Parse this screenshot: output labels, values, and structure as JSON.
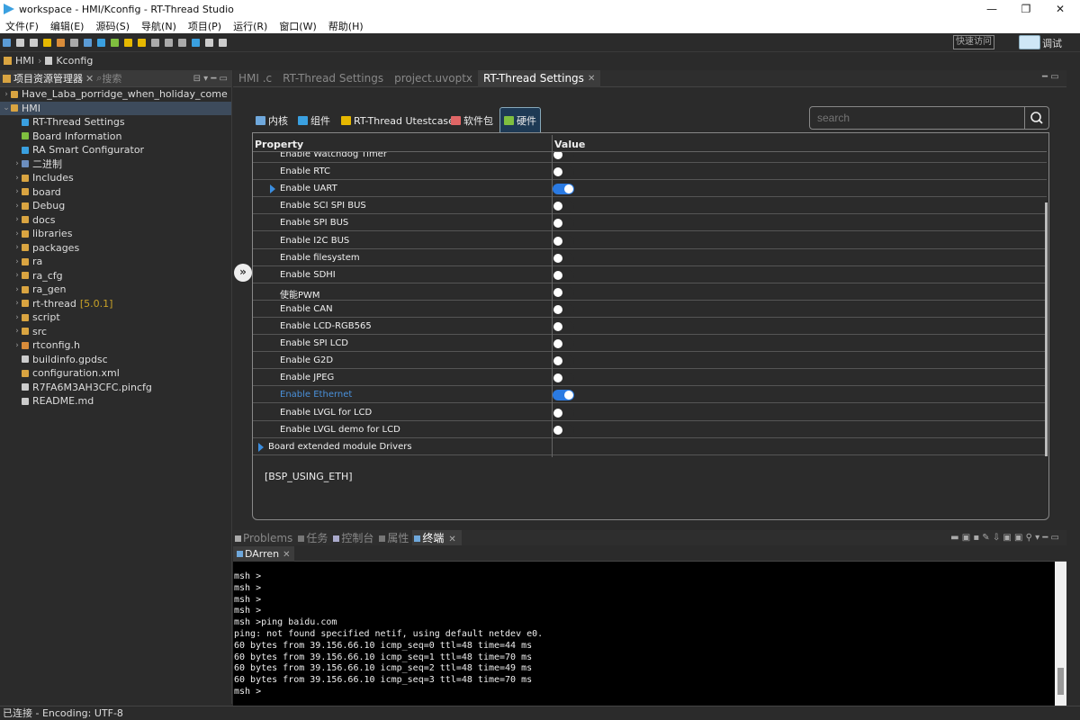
{
  "window": {
    "title": "workspace - HMI/Kconfig - RT-Thread Studio"
  },
  "menu": [
    "文件(F)",
    "编辑(E)",
    "源码(S)",
    "导航(N)",
    "项目(P)",
    "运行(R)",
    "窗口(W)",
    "帮助(H)"
  ],
  "toolbar": {
    "quick_access": "快速访问",
    "debug_label": "调试"
  },
  "breadcrumb": {
    "project": "HMI",
    "file": "Kconfig"
  },
  "explorer": {
    "tab_label": "项目资源管理器",
    "search_tab": "搜索",
    "items": [
      {
        "label": "Have_Laba_porridge_when_holiday_come",
        "level": 0,
        "twist": "›",
        "color": "#d9a441"
      },
      {
        "label": "HMI",
        "level": 0,
        "twist": "⌄",
        "color": "#d9a441",
        "selected": true
      },
      {
        "label": "RT-Thread Settings",
        "level": 1,
        "twist": "",
        "color": "#3aa0e0"
      },
      {
        "label": "Board Information",
        "level": 1,
        "twist": "",
        "color": "#7fbf3f"
      },
      {
        "label": "RA Smart Configurator",
        "level": 1,
        "twist": "",
        "color": "#3aa0e0"
      },
      {
        "label": "二进制",
        "level": 1,
        "twist": "›",
        "color": "#6c8ebf"
      },
      {
        "label": "Includes",
        "level": 1,
        "twist": "›",
        "color": "#d9a441"
      },
      {
        "label": "board",
        "level": 1,
        "twist": "›",
        "color": "#d9a441"
      },
      {
        "label": "Debug",
        "level": 1,
        "twist": "›",
        "color": "#d9a441"
      },
      {
        "label": "docs",
        "level": 1,
        "twist": "›",
        "color": "#d9a441"
      },
      {
        "label": "libraries",
        "level": 1,
        "twist": "›",
        "color": "#d9a441"
      },
      {
        "label": "packages",
        "level": 1,
        "twist": "›",
        "color": "#d9a441"
      },
      {
        "label": "ra",
        "level": 1,
        "twist": "›",
        "color": "#d9a441"
      },
      {
        "label": "ra_cfg",
        "level": 1,
        "twist": "›",
        "color": "#d9a441"
      },
      {
        "label": "ra_gen",
        "level": 1,
        "twist": "›",
        "color": "#d9a441"
      },
      {
        "label": "rt-thread",
        "version": "[5.0.1]",
        "level": 1,
        "twist": "›",
        "color": "#d9a441"
      },
      {
        "label": "script",
        "level": 1,
        "twist": "›",
        "color": "#d9a441"
      },
      {
        "label": "src",
        "level": 1,
        "twist": "›",
        "color": "#d9a441"
      },
      {
        "label": "rtconfig.h",
        "level": 1,
        "twist": "›",
        "color": "#d98c3a"
      },
      {
        "label": "buildinfo.gpdsc",
        "level": 1,
        "twist": "",
        "color": "#cccccc"
      },
      {
        "label": "configuration.xml",
        "level": 1,
        "twist": "",
        "color": "#d9a441"
      },
      {
        "label": "R7FA6M3AH3CFC.pincfg",
        "level": 1,
        "twist": "",
        "color": "#cccccc"
      },
      {
        "label": "README.md",
        "level": 1,
        "twist": "",
        "color": "#cccccc"
      }
    ]
  },
  "editor_tabs": [
    {
      "label": "HMI .c",
      "active": false
    },
    {
      "label": "RT-Thread Settings",
      "active": false
    },
    {
      "label": "project.uvoptx",
      "active": false
    },
    {
      "label": "RT-Thread Settings",
      "active": true
    }
  ],
  "settings": {
    "tabs": [
      {
        "label": "内核",
        "color": "#6fa8dc",
        "active": false
      },
      {
        "label": "组件",
        "color": "#3aa0e0",
        "active": false
      },
      {
        "label": "RT-Thread Utestcases",
        "color": "#e6b800",
        "active": false
      },
      {
        "label": "软件包",
        "color": "#e06666",
        "active": false
      },
      {
        "label": "硬件",
        "color": "#7fbf3f",
        "active": true
      }
    ],
    "search_placeholder": "search",
    "columns": {
      "property": "Property",
      "value": "Value"
    },
    "rows": [
      {
        "label": "Enable Watchdog Timer",
        "toggle": "off"
      },
      {
        "label": "Enable RTC",
        "toggle": "off"
      },
      {
        "label": "Enable UART",
        "toggle": "on",
        "expand": true
      },
      {
        "label": "Enable SCI SPI BUS",
        "toggle": "off"
      },
      {
        "label": "Enable SPI BUS",
        "toggle": "off"
      },
      {
        "label": "Enable I2C BUS",
        "toggle": "off"
      },
      {
        "label": "Enable filesystem",
        "toggle": "off"
      },
      {
        "label": "Enable SDHI",
        "toggle": "off"
      },
      {
        "label": "使能PWM",
        "toggle": "off"
      },
      {
        "label": "Enable CAN",
        "toggle": "off"
      },
      {
        "label": "Enable LCD-RGB565",
        "toggle": "off"
      },
      {
        "label": "Enable SPI LCD",
        "toggle": "off"
      },
      {
        "label": "Enable G2D",
        "toggle": "off"
      },
      {
        "label": "Enable JPEG",
        "toggle": "off"
      },
      {
        "label": "Enable Ethernet",
        "toggle": "on",
        "highlight": true
      },
      {
        "label": "Enable LVGL for LCD",
        "toggle": "off"
      },
      {
        "label": "Enable LVGL demo for LCD",
        "toggle": "off"
      },
      {
        "label": "Board extended module Drivers",
        "toggle": "none",
        "expand": true,
        "group": true
      }
    ],
    "macro": "[BSP_USING_ETH]"
  },
  "bottom_tabs": [
    "Problems",
    "任务",
    "控制台",
    "属性",
    "终端"
  ],
  "terminal": {
    "tab": "DArren",
    "lines": [
      "msh >",
      "msh >",
      "msh >",
      "msh >",
      "msh >ping baidu.com",
      "ping: not found specified netif, using default netdev e0.",
      "60 bytes from 39.156.66.10 icmp_seq=0 ttl=48 time=44 ms",
      "60 bytes from 39.156.66.10 icmp_seq=1 ttl=48 time=70 ms",
      "60 bytes from 39.156.66.10 icmp_seq=2 ttl=48 time=49 ms",
      "60 bytes from 39.156.66.10 icmp_seq=3 ttl=48 time=70 ms",
      "msh >"
    ]
  },
  "status": {
    "text": "已连接 - Encoding: UTF-8"
  }
}
